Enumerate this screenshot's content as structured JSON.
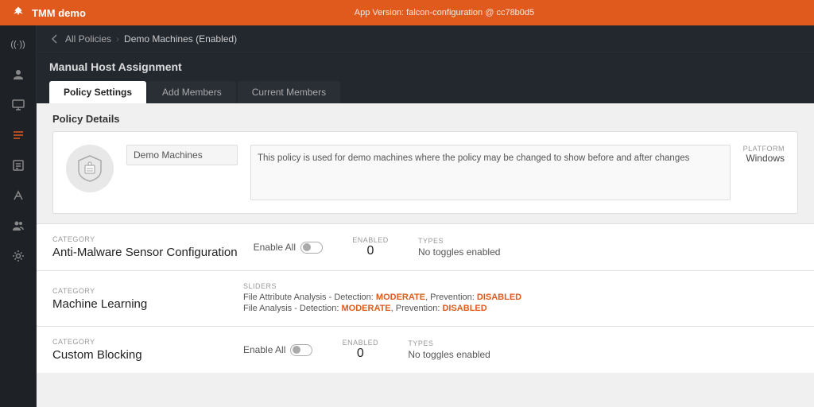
{
  "topbar": {
    "logo_unicode": "🦅",
    "title": "TMM demo",
    "app_version": "App Version: falcon-configuration @ cc78b0d5"
  },
  "sidebar": {
    "logo_unicode": "🦅",
    "items": [
      {
        "name": "signal-icon",
        "unicode": "((·))",
        "active": false
      },
      {
        "name": "user-icon",
        "unicode": "👤",
        "active": false
      },
      {
        "name": "monitor-icon",
        "unicode": "🖥",
        "active": false
      },
      {
        "name": "policy-icon",
        "unicode": "☰",
        "active": true
      },
      {
        "name": "report-icon",
        "unicode": "📊",
        "active": false
      },
      {
        "name": "network-icon",
        "unicode": "⚡",
        "active": false
      },
      {
        "name": "group-icon",
        "unicode": "👥",
        "active": false
      },
      {
        "name": "settings-icon",
        "unicode": "⚙",
        "active": false
      }
    ]
  },
  "breadcrumb": {
    "items": [
      {
        "label": "All Policies",
        "link": true
      },
      {
        "label": "Demo Machines (Enabled)",
        "link": false
      }
    ]
  },
  "page": {
    "title": "Manual Host Assignment",
    "tabs": [
      {
        "label": "Policy Settings",
        "active": true
      },
      {
        "label": "Add Members",
        "active": false
      },
      {
        "label": "Current Members",
        "active": false
      }
    ]
  },
  "policy_details": {
    "section_title": "Policy Details",
    "icon_unicode": "🛡",
    "name": "Demo Machines",
    "description": "This policy is used for demo machines where the policy may be changed to show before and after changes",
    "platform_label": "PLATFORM",
    "platform_value": "Windows"
  },
  "categories": [
    {
      "label": "CATEGORY",
      "name": "Anti-Malware Sensor Configuration",
      "has_enable_all": true,
      "enable_all_label": "Enable All",
      "enabled_label": "ENABLED",
      "enabled_value": "0",
      "toggles_label": "TYPES",
      "toggles_value": "No toggles enabled",
      "has_sliders": false
    },
    {
      "label": "CATEGORY",
      "name": "Machine Learning",
      "has_enable_all": false,
      "has_sliders": true,
      "sliders_label": "SLIDERS",
      "sliders": [
        {
          "text_before": "File Attribute Analysis - Detection: ",
          "highlight1": "MODERATE",
          "text_middle": ", Prevention: ",
          "highlight2": "DISABLED"
        },
        {
          "text_before": "File Analysis - Detection: ",
          "highlight1": "MODERATE",
          "text_middle": ", Prevention: ",
          "highlight2": "DISABLED"
        }
      ]
    },
    {
      "label": "CATEGORY",
      "name": "Custom Blocking",
      "has_enable_all": true,
      "enable_all_label": "Enable All",
      "enabled_label": "ENABLED",
      "enabled_value": "0",
      "toggles_label": "TYPES",
      "toggles_value": "No toggles enabled",
      "has_sliders": false
    }
  ]
}
